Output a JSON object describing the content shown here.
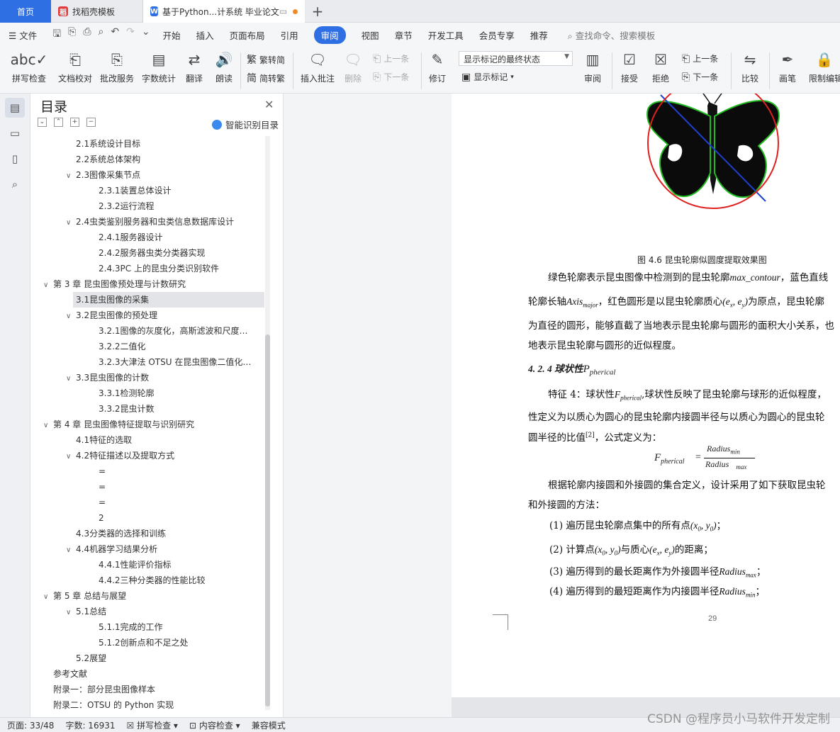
{
  "tabs": {
    "home": "首页",
    "template": "找稻壳模板",
    "doc": "基于Python...计系统 毕业论文"
  },
  "menu": {
    "file": "文件",
    "items": [
      "开始",
      "插入",
      "页面布局",
      "引用",
      "审阅",
      "视图",
      "章节",
      "开发工具",
      "会员专享",
      "推荐"
    ],
    "active": "审阅",
    "search": "查找命令、搜索模板"
  },
  "ribbon": {
    "spell": "拼写检查",
    "proof": "文档校对",
    "batch": "批改服务",
    "count": "字数统计",
    "translate": "翻译",
    "read": "朗读",
    "t2s": "繁转简",
    "s2t": "简转繁",
    "insert_comment": "插入批注",
    "delete": "删除",
    "prev": "上一条",
    "next": "下一条",
    "revise": "修订",
    "markup_state": "显示标记的最终状态",
    "show_markup": "显示标记",
    "review": "审阅",
    "accept": "接受",
    "reject": "拒绝",
    "prev2": "上一条",
    "next2": "下一条",
    "compare": "比较",
    "ink": "画笔",
    "restrict": "限制编辑"
  },
  "toc": {
    "title": "目录",
    "smart": "智能识别目录",
    "items": [
      {
        "text": "2.1系统设计目标",
        "level": 2,
        "caret": ""
      },
      {
        "text": "2.2系统总体架构",
        "level": 2,
        "caret": ""
      },
      {
        "text": "2.3图像采集节点",
        "level": 2,
        "caret": "∨"
      },
      {
        "text": "2.3.1装置总体设计",
        "level": 3,
        "caret": ""
      },
      {
        "text": "2.3.2运行流程",
        "level": 3,
        "caret": ""
      },
      {
        "text": "2.4虫类鉴别服务器和虫类信息数据库设计",
        "level": 2,
        "caret": "∨"
      },
      {
        "text": "2.4.1服务器设计",
        "level": 3,
        "caret": ""
      },
      {
        "text": "2.4.2服务器虫类分类器实现",
        "level": 3,
        "caret": ""
      },
      {
        "text": "2.4.3PC 上的昆虫分类识别软件",
        "level": 3,
        "caret": ""
      },
      {
        "text": "第 3 章 昆虫图像预处理与计数研究",
        "level": 1,
        "caret": "∨"
      },
      {
        "text": "3.1昆虫图像的采集",
        "level": 2,
        "caret": "",
        "selected": true
      },
      {
        "text": "3.2昆虫图像的预处理",
        "level": 2,
        "caret": "∨"
      },
      {
        "text": "3.2.1图像的灰度化，高斯滤波和尺度…",
        "level": 3,
        "caret": ""
      },
      {
        "text": "3.2.2二值化",
        "level": 3,
        "caret": ""
      },
      {
        "text": "3.2.3大津法 OTSU 在昆虫图像二值化…",
        "level": 3,
        "caret": ""
      },
      {
        "text": "3.3昆虫图像的计数",
        "level": 2,
        "caret": "∨"
      },
      {
        "text": "3.3.1检测轮廓",
        "level": 3,
        "caret": ""
      },
      {
        "text": "3.3.2昆虫计数",
        "level": 3,
        "caret": ""
      },
      {
        "text": "第 4 章 昆虫图像特征提取与识别研究",
        "level": 1,
        "caret": "∨"
      },
      {
        "text": "4.1特征的选取",
        "level": 2,
        "caret": ""
      },
      {
        "text": "4.2特征描述以及提取方式",
        "level": 2,
        "caret": "∨"
      },
      {
        "text": "=",
        "level": 3,
        "caret": ""
      },
      {
        "text": "=",
        "level": 3,
        "caret": ""
      },
      {
        "text": "=",
        "level": 3,
        "caret": ""
      },
      {
        "text": "2",
        "level": 3,
        "caret": ""
      },
      {
        "text": "4.3分类器的选择和训练",
        "level": 2,
        "caret": ""
      },
      {
        "text": "4.4机器学习结果分析",
        "level": 2,
        "caret": "∨"
      },
      {
        "text": "4.4.1性能评价指标",
        "level": 3,
        "caret": ""
      },
      {
        "text": "4.4.2三种分类器的性能比较",
        "level": 3,
        "caret": ""
      },
      {
        "text": "第 5 章 总结与展望",
        "level": 1,
        "caret": "∨"
      },
      {
        "text": "5.1总结",
        "level": 2,
        "caret": "∨"
      },
      {
        "text": "5.1.1完成的工作",
        "level": 3,
        "caret": ""
      },
      {
        "text": "5.1.2创新点和不足之处",
        "level": 3,
        "caret": ""
      },
      {
        "text": "5.2展望",
        "level": 2,
        "caret": ""
      },
      {
        "text": "参考文献",
        "level": 1,
        "caret": ""
      },
      {
        "text": "附录一：部分昆虫图像样本",
        "level": 1,
        "caret": ""
      },
      {
        "text": "附录二：OTSU 的 Python 实现",
        "level": 1,
        "caret": ""
      }
    ]
  },
  "doc": {
    "caption": "图 4.6 昆虫轮廓似圆度提取效果图",
    "p1a": "绿色轮廓表示昆虫图像中检测到的昆虫轮廓",
    "p1a_it": "max_contour",
    "p1a2": "，蓝色直线",
    "p1b": "轮廓长轴",
    "p1b_it": "Axis",
    "p1b_sub": "major",
    "p1b2": "，红色圆形是以昆虫轮廓质心",
    "p1b_it2": "(e",
    "p1b_sub2": "x",
    "p1b_it3": ", e",
    "p1b_sub3": "y",
    "p1b_it4": ")",
    "p1b3": "为原点，昆虫轮廓",
    "p1c": "为直径的圆形，能够直截了当地表示昆虫轮廓与圆形的面积大小关系，也",
    "p1d": "地表示昆虫轮廓与圆形的近似程度。",
    "h424": "4. 2. 4 球状性",
    "h424_it": "P",
    "h424_sub": "pherical",
    "p2a": "特征 4：球状性",
    "p2a_it": "F",
    "p2a_sub": "pherical",
    "p2a2": ",球状性反映了昆虫轮廓与球形的近似程度，",
    "p2b": "性定义为以质心为圆心的昆虫轮廓内接圆半径与以质心为圆心的昆虫轮",
    "p2c": "圆半径的比值",
    "p2c_ref": "[2]",
    "p2c2": "，公式定义为：",
    "f_left": "F",
    "f_left_sub": "pherical",
    "f_eq": "=",
    "f_num": "Radius",
    "f_num_sub": "min",
    "f_den": "Radius",
    "f_den_sub": "max",
    "p3a": "根据轮廓内接圆和外接圆的集合定义，设计采用了如下获取昆虫轮",
    "p3b": "和外接圆的方法：",
    "s1": "(1) 遍历昆虫轮廓点集中的所有点",
    "s1_it": "(x",
    "s1_sub": "0",
    "s1_it2": ", y",
    "s1_sub2": "0",
    "s1_it3": ")",
    "s1_end": "；",
    "s2": "(2) 计算点",
    "s2_it": "(x",
    "s2_sub": "0",
    "s2_it2": ", y",
    "s2_sub2": "0",
    "s2_it3": ")",
    "s2b": "与质心",
    "s2_it4": "(e",
    "s2_sub4": "x",
    "s2_it5": ", e",
    "s2_sub5": "y",
    "s2_it6": ")",
    "s2c": "的距离；",
    "s3": "(3) 遍历得到的最长距离作为外接圆半径",
    "s3_it": "Radius",
    "s3_sub": "max",
    "s3_end": "；",
    "s4": "(4) 遍历得到的最短距离作为内接圆半径",
    "s4_it": "Radius",
    "s4_sub": "min",
    "s4_end": "；",
    "page_number": "29"
  },
  "status": {
    "page": "页面: 33/48",
    "words": "字数: 16931",
    "spell": "拼写检查",
    "content": "内容检查",
    "compat": "兼容模式"
  },
  "watermark": "CSDN @程序员小马软件开发定制",
  "colors": {
    "accent": "#2f6fe4",
    "contour": "#22bb22",
    "circle": "#e02020",
    "axis": "#1f3fcf"
  }
}
